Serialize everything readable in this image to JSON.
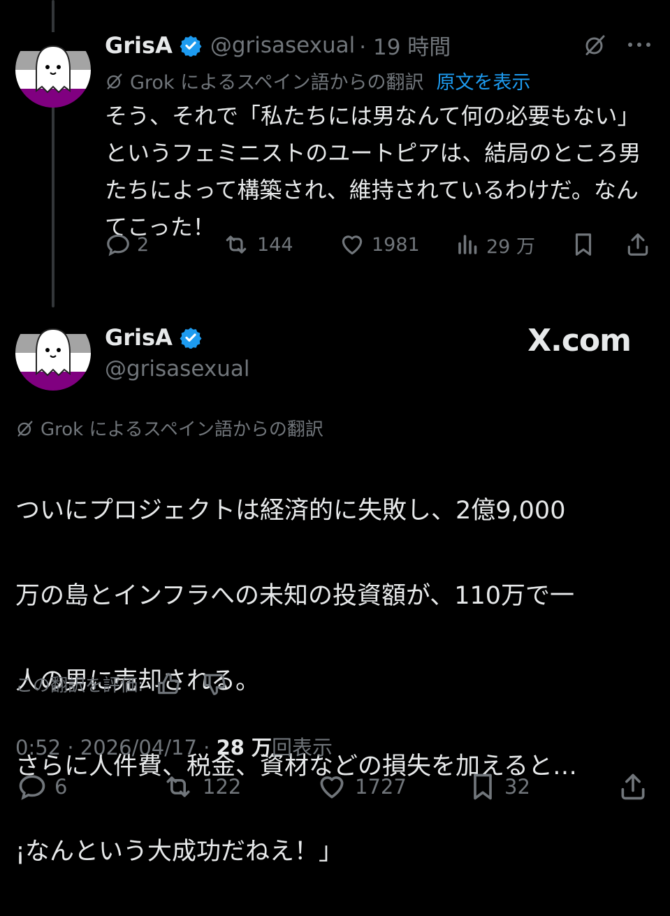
{
  "parent": {
    "name": "GrisA",
    "handle": "@grisasexual",
    "time": "· 19 時間",
    "translation_label": "Grok によるスペイン語からの翻訳",
    "show_original": "原文を表示",
    "text": "そう、それで「私たちには男なんて何の必要もない」というフェミニストのユートピアは、結局のところ男たちによって構築され、維持されているわけだ。なんてこった！",
    "replies": "2",
    "reposts": "144",
    "likes": "1981",
    "views": "29 万"
  },
  "main": {
    "name": "GrisA",
    "handle": "@grisasexual",
    "brand": "X.com",
    "translation_label": "Grok によるスペイン語からの翻訳",
    "text_lines": [
      "ついにプロジェクトは経済的に失敗し、2億9,000",
      "万の島とインフラへの未知の投資額が、110万で一",
      "人の男に売却される。",
      "さらに人件費、税金、資材などの損失を加えると…",
      "¡なんという大成功だねえ！」"
    ],
    "rate_label": "この翻訳を評価:",
    "time": "0:52",
    "date": "2026/04/17",
    "views_count": "28 万",
    "views_label": "回表示",
    "replies": "6",
    "reposts": "122",
    "likes": "1727",
    "bookmarks": "32"
  },
  "colors": {
    "background": "#000000",
    "text": "#e7e9ea",
    "muted": "#71767b",
    "accent": "#1d9bf0"
  },
  "icons": [
    "grok-icon",
    "more-icon",
    "reply-icon",
    "repost-icon",
    "like-icon",
    "views-icon",
    "bookmark-icon",
    "share-icon",
    "verified-icon",
    "thumbs-up-icon",
    "thumbs-down-icon"
  ]
}
